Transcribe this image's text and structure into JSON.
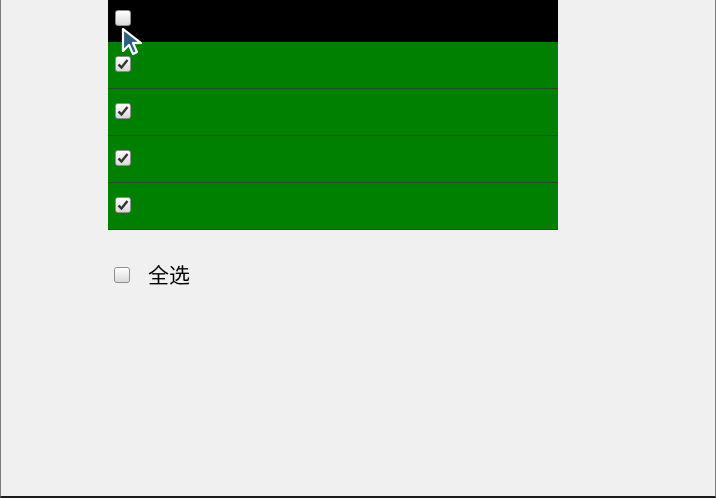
{
  "list": {
    "items": [
      {
        "checked": false
      },
      {
        "checked": true
      },
      {
        "checked": true
      },
      {
        "checked": true
      },
      {
        "checked": true
      }
    ]
  },
  "select_all": {
    "label": "全选",
    "checked": false
  },
  "colors": {
    "row_unchecked_bg": "#000000",
    "row_checked_bg": "#008000",
    "page_bg": "#f0f0f0"
  },
  "icons": {
    "checkmark": "check-icon",
    "cursor": "pointer-cursor-icon"
  }
}
